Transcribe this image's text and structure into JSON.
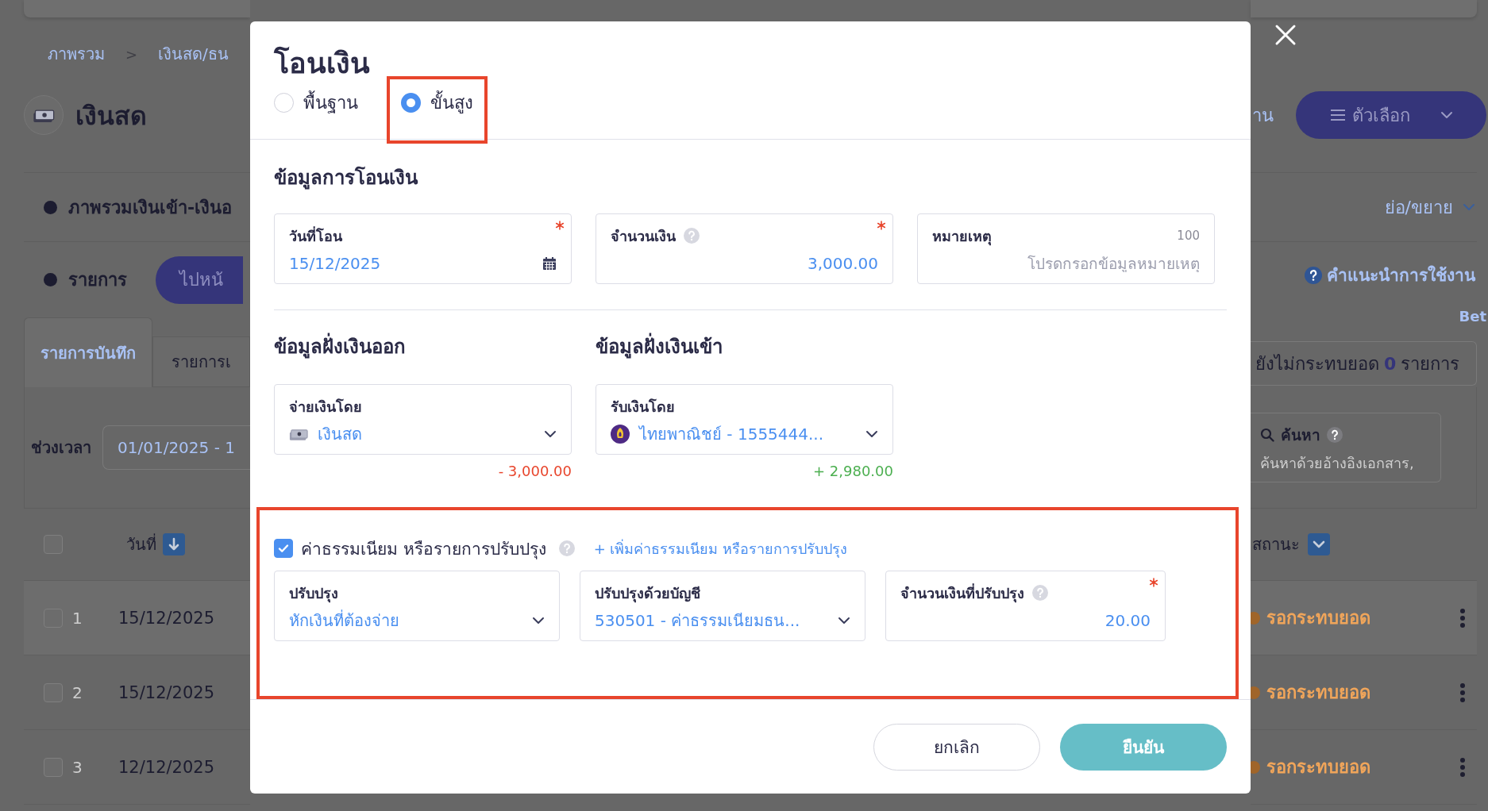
{
  "background_page": {
    "breadcrumb": [
      {
        "kind": "link",
        "text": "ภาพรวม"
      },
      {
        "kind": "separator",
        "text": ">"
      },
      {
        "kind": "link",
        "text": "เงินสด/ธน"
      }
    ],
    "page_title": "เงินสด",
    "header_link": "าน",
    "options_button": "ตัวเลือก",
    "overview": {
      "title": "ภาพรวมเงินเข้า-เงินอ",
      "toggle": "ย่อ/ขยาย"
    },
    "list_section": {
      "title": "รายการ",
      "button": "ไปหน้",
      "help_link": "คำแนะนำการใช้งาน"
    },
    "beta_label": "Bet",
    "tabs": [
      {
        "label": "รายการบันทึก",
        "selected": true
      },
      {
        "label": "รายการเ",
        "selected": false
      }
    ],
    "unreconciled": "ยังไม่กระทบยอด **0** รายการ",
    "period": {
      "label": "ช่วงเวลา",
      "value": "01/01/2025 - 1"
    },
    "search": {
      "label": "ค้นหา",
      "placeholder": "ค้นหาด้วยอ้างอิงเอกสาร,"
    },
    "table": {
      "select_all_checked": false,
      "columns": [
        "วันที่",
        "สถานะ"
      ],
      "rows": [
        {
          "number": "1",
          "date": "15/12/2025",
          "status": "รอกระทบยอด",
          "checked": false
        },
        {
          "number": "2",
          "date": "15/12/2025",
          "status": "รอกระทบยอด",
          "checked": false
        },
        {
          "number": "3",
          "date": "12/12/2025",
          "status": "รอกระทบยอด",
          "checked": false
        }
      ]
    }
  },
  "dialog": {
    "title": "โอนเงิน",
    "modes": [
      {
        "label": "พื้นฐาน",
        "selected": false,
        "highlighted": false
      },
      {
        "label": "ขั้นสูง",
        "selected": true,
        "highlighted": true
      }
    ],
    "transfer_info": {
      "heading": "ข้อมูลการโอนเงิน",
      "fields": [
        {
          "kind": "date",
          "label": "วันที่โอน",
          "value": "15/12/2025",
          "required": true,
          "help": false
        },
        {
          "kind": "amount",
          "label": "จำนวนเงิน",
          "value": "3,000.00",
          "required": true,
          "help": true
        },
        {
          "kind": "note",
          "label": "หมายเหตุ",
          "counter": "100",
          "placeholder": "โปรดกรอกข้อมูลหมายเหตุ",
          "required": false,
          "help": false
        }
      ]
    },
    "outgoing": {
      "heading": "ข้อมูลฝั่งเงินออก",
      "field": {
        "kind": "select",
        "label": "จ่ายเงินโดย",
        "value": "เงินสด",
        "required": false,
        "help": false
      },
      "amount": "- 3,000.00"
    },
    "incoming": {
      "heading": "ข้อมูลฝั่งเงินเข้า",
      "field": {
        "kind": "select",
        "label": "รับเงินโดย",
        "value": "ไทยพาณิชย์ - 1555444...",
        "required": false,
        "help": false
      },
      "amount": "+ 2,980.00"
    },
    "adjustments": {
      "checked": true,
      "highlighted": true,
      "label": "ค่าธรรมเนียม หรือรายการปรับปรุง",
      "help": true,
      "add_link": "+ เพิ่มค่าธรรมเนียม หรือรายการปรับปรุง",
      "fields": [
        {
          "kind": "select",
          "label": "ปรับปรุง",
          "value": "หักเงินที่ต้องจ่าย",
          "required": false,
          "help": false
        },
        {
          "kind": "select",
          "label": "ปรับปรุงด้วยบัญชี",
          "value": "530501 - ค่าธรรมเนียมธน...",
          "required": false,
          "help": false
        },
        {
          "kind": "amount",
          "label": "จำนวนเงินที่ปรับปรุง",
          "value": "20.00",
          "required": true,
          "help": true
        }
      ]
    },
    "buttons": [
      {
        "kind": "secondary",
        "label": "ยกเลิก"
      },
      {
        "kind": "primary",
        "label": "ยืนยัน"
      }
    ]
  }
}
